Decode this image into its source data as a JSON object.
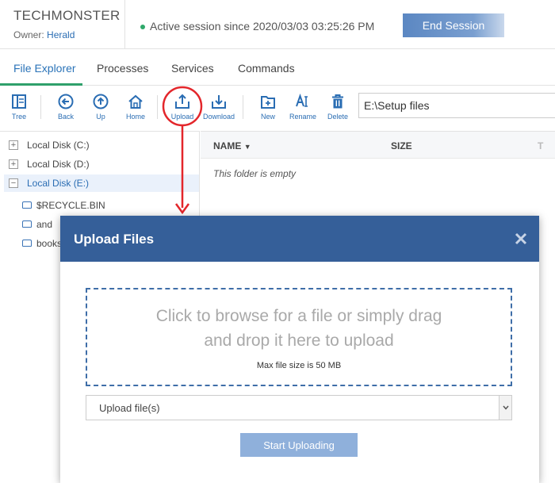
{
  "brand": {
    "name": "TECHMONSTER",
    "owner_prefix": "Owner:",
    "owner_name": "Herald"
  },
  "session": {
    "text": "Active session since 2020/03/03 03:25:26 PM",
    "end_label": "End Session"
  },
  "tabs": [
    {
      "label": "File Explorer",
      "active": true
    },
    {
      "label": "Processes"
    },
    {
      "label": "Services"
    },
    {
      "label": "Commands"
    }
  ],
  "toolbar": {
    "tree": "Tree",
    "back": "Back",
    "up": "Up",
    "home": "Home",
    "upload": "Upload",
    "download": "Download",
    "new": "New",
    "rename": "Rename",
    "delete": "Delete",
    "path_value": "E:\\Setup files"
  },
  "tree": {
    "disks": [
      {
        "label": "Local Disk (C:)",
        "expander": "+"
      },
      {
        "label": "Local Disk (D:)",
        "expander": "+"
      },
      {
        "label": "Local Disk (E:)",
        "expander": "−",
        "selected": true
      }
    ],
    "folders": [
      "$RECYCLE.BIN",
      "and",
      "books"
    ]
  },
  "filelist": {
    "col_name": "NAME",
    "col_size": "SIZE",
    "col_more": "T",
    "empty": "This folder is empty"
  },
  "modal": {
    "title": "Upload Files",
    "drop_line1": "Click to browse for a file or simply drag",
    "drop_line2": "and drop it here to upload",
    "max_size": "Max file size is 50 MB",
    "select_value": "Upload file(s)",
    "start_label": "Start Uploading"
  },
  "colors": {
    "accent_blue": "#2a6db3",
    "modal_header": "#355f99",
    "active_tab_underline": "#2fa06b",
    "callout_red": "#e3262b",
    "session_dot": "#2fa86a"
  }
}
